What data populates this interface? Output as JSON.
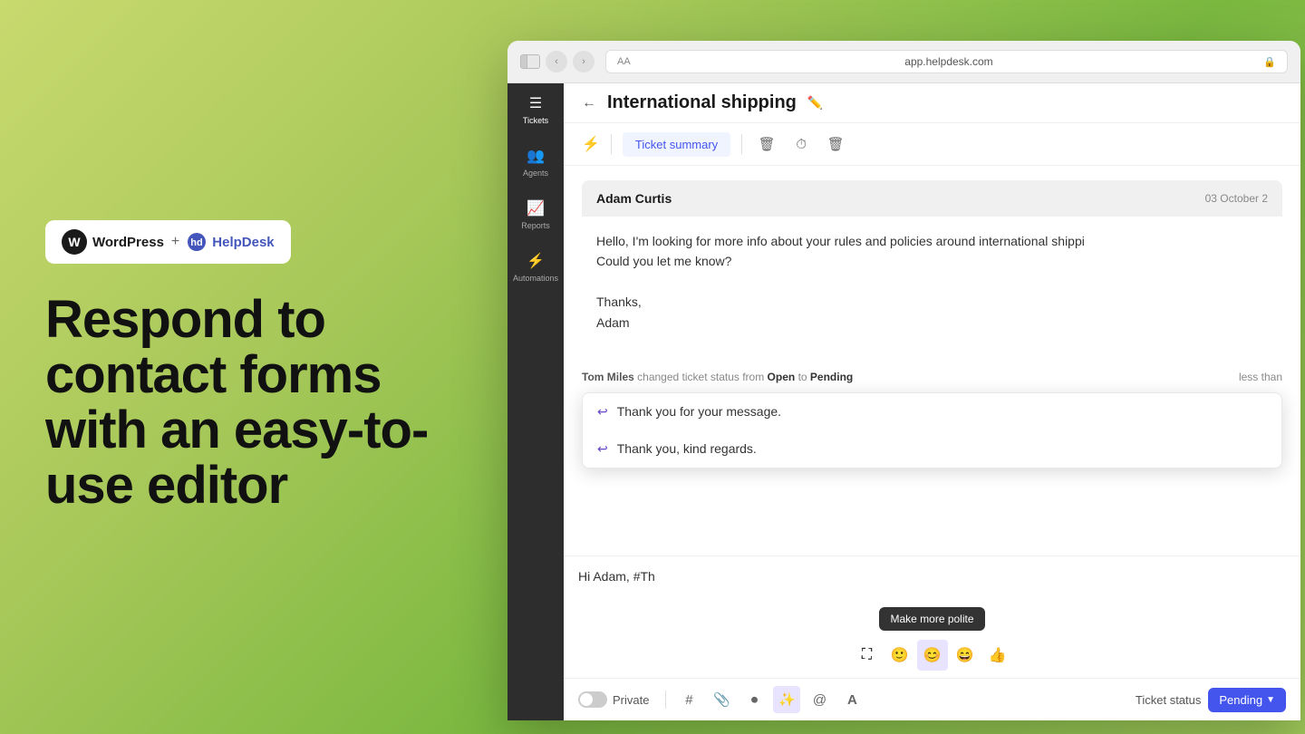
{
  "background": {
    "gradient": "linear-gradient(135deg, #c8d96e 0%, #a8c85a 30%, #7ab840 60%, #9fc95a 100%)"
  },
  "logo_bar": {
    "wordpress_label": "WordPress",
    "plus": "+",
    "helpdesk_label": "HelpDesk"
  },
  "headline": {
    "line1": "Respond to",
    "line2": "contact forms",
    "line3": "with an easy-to-",
    "line4": "use editor"
  },
  "browser": {
    "address": "app.helpdesk.com",
    "aa_label": "AA"
  },
  "sidebar": {
    "items": [
      {
        "label": "Tickets",
        "icon": "🎫"
      },
      {
        "label": "Agents",
        "icon": "👥"
      },
      {
        "label": "Reports",
        "icon": "📊"
      },
      {
        "label": "Automations",
        "icon": "⚡"
      }
    ]
  },
  "ticket": {
    "title": "International shipping",
    "toolbar": {
      "tab_active": "Ticket summary",
      "btn_trash": "🗑",
      "btn_clock": "⏰",
      "btn_delete": "🗑"
    },
    "message": {
      "sender": "Adam Curtis",
      "date": "03 October 2",
      "body_line1": "Hello, I'm looking for more info about your rules and policies around international shippi",
      "body_line2": "Could you let me know?",
      "body_line3": "",
      "body_thanks": "Thanks,",
      "body_sig": "Adam"
    },
    "status_change": {
      "agent": "Tom Miles",
      "action": "changed ticket status from",
      "from": "Open",
      "to_word": "to",
      "to": "Pending",
      "time": "less than"
    },
    "autocomplete": {
      "items": [
        {
          "text": "Thank you for your message."
        },
        {
          "text": "Thank you, kind regards."
        }
      ]
    },
    "compose": {
      "text": "Hi Adam,   #Th"
    },
    "tooltip": {
      "text": "Make more polite"
    },
    "emoji_bar": {
      "icons": [
        "⛶",
        "🙂",
        "😊",
        "😄",
        "👍"
      ]
    },
    "bottom_toolbar": {
      "private_label": "Private",
      "icons": [
        "#",
        "📎",
        "⏺",
        "✏️",
        "@",
        "A"
      ],
      "status_label": "Ticket status",
      "status_value": "Pending"
    }
  }
}
